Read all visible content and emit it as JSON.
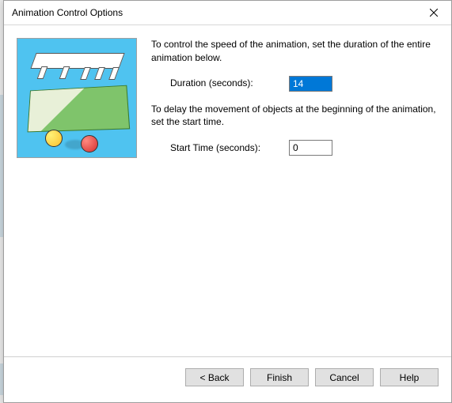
{
  "window": {
    "title": "Animation Control Options"
  },
  "instructions": {
    "speed": "To control the speed of the animation, set the duration of the entire animation below.",
    "delay": "To delay the movement of objects at the beginning of the animation, set the start time."
  },
  "fields": {
    "duration": {
      "label": "Duration (seconds):",
      "value": "14"
    },
    "start_time": {
      "label": "Start Time (seconds):",
      "value": "0"
    }
  },
  "buttons": {
    "back": "< Back",
    "finish": "Finish",
    "cancel": "Cancel",
    "help": "Help"
  }
}
